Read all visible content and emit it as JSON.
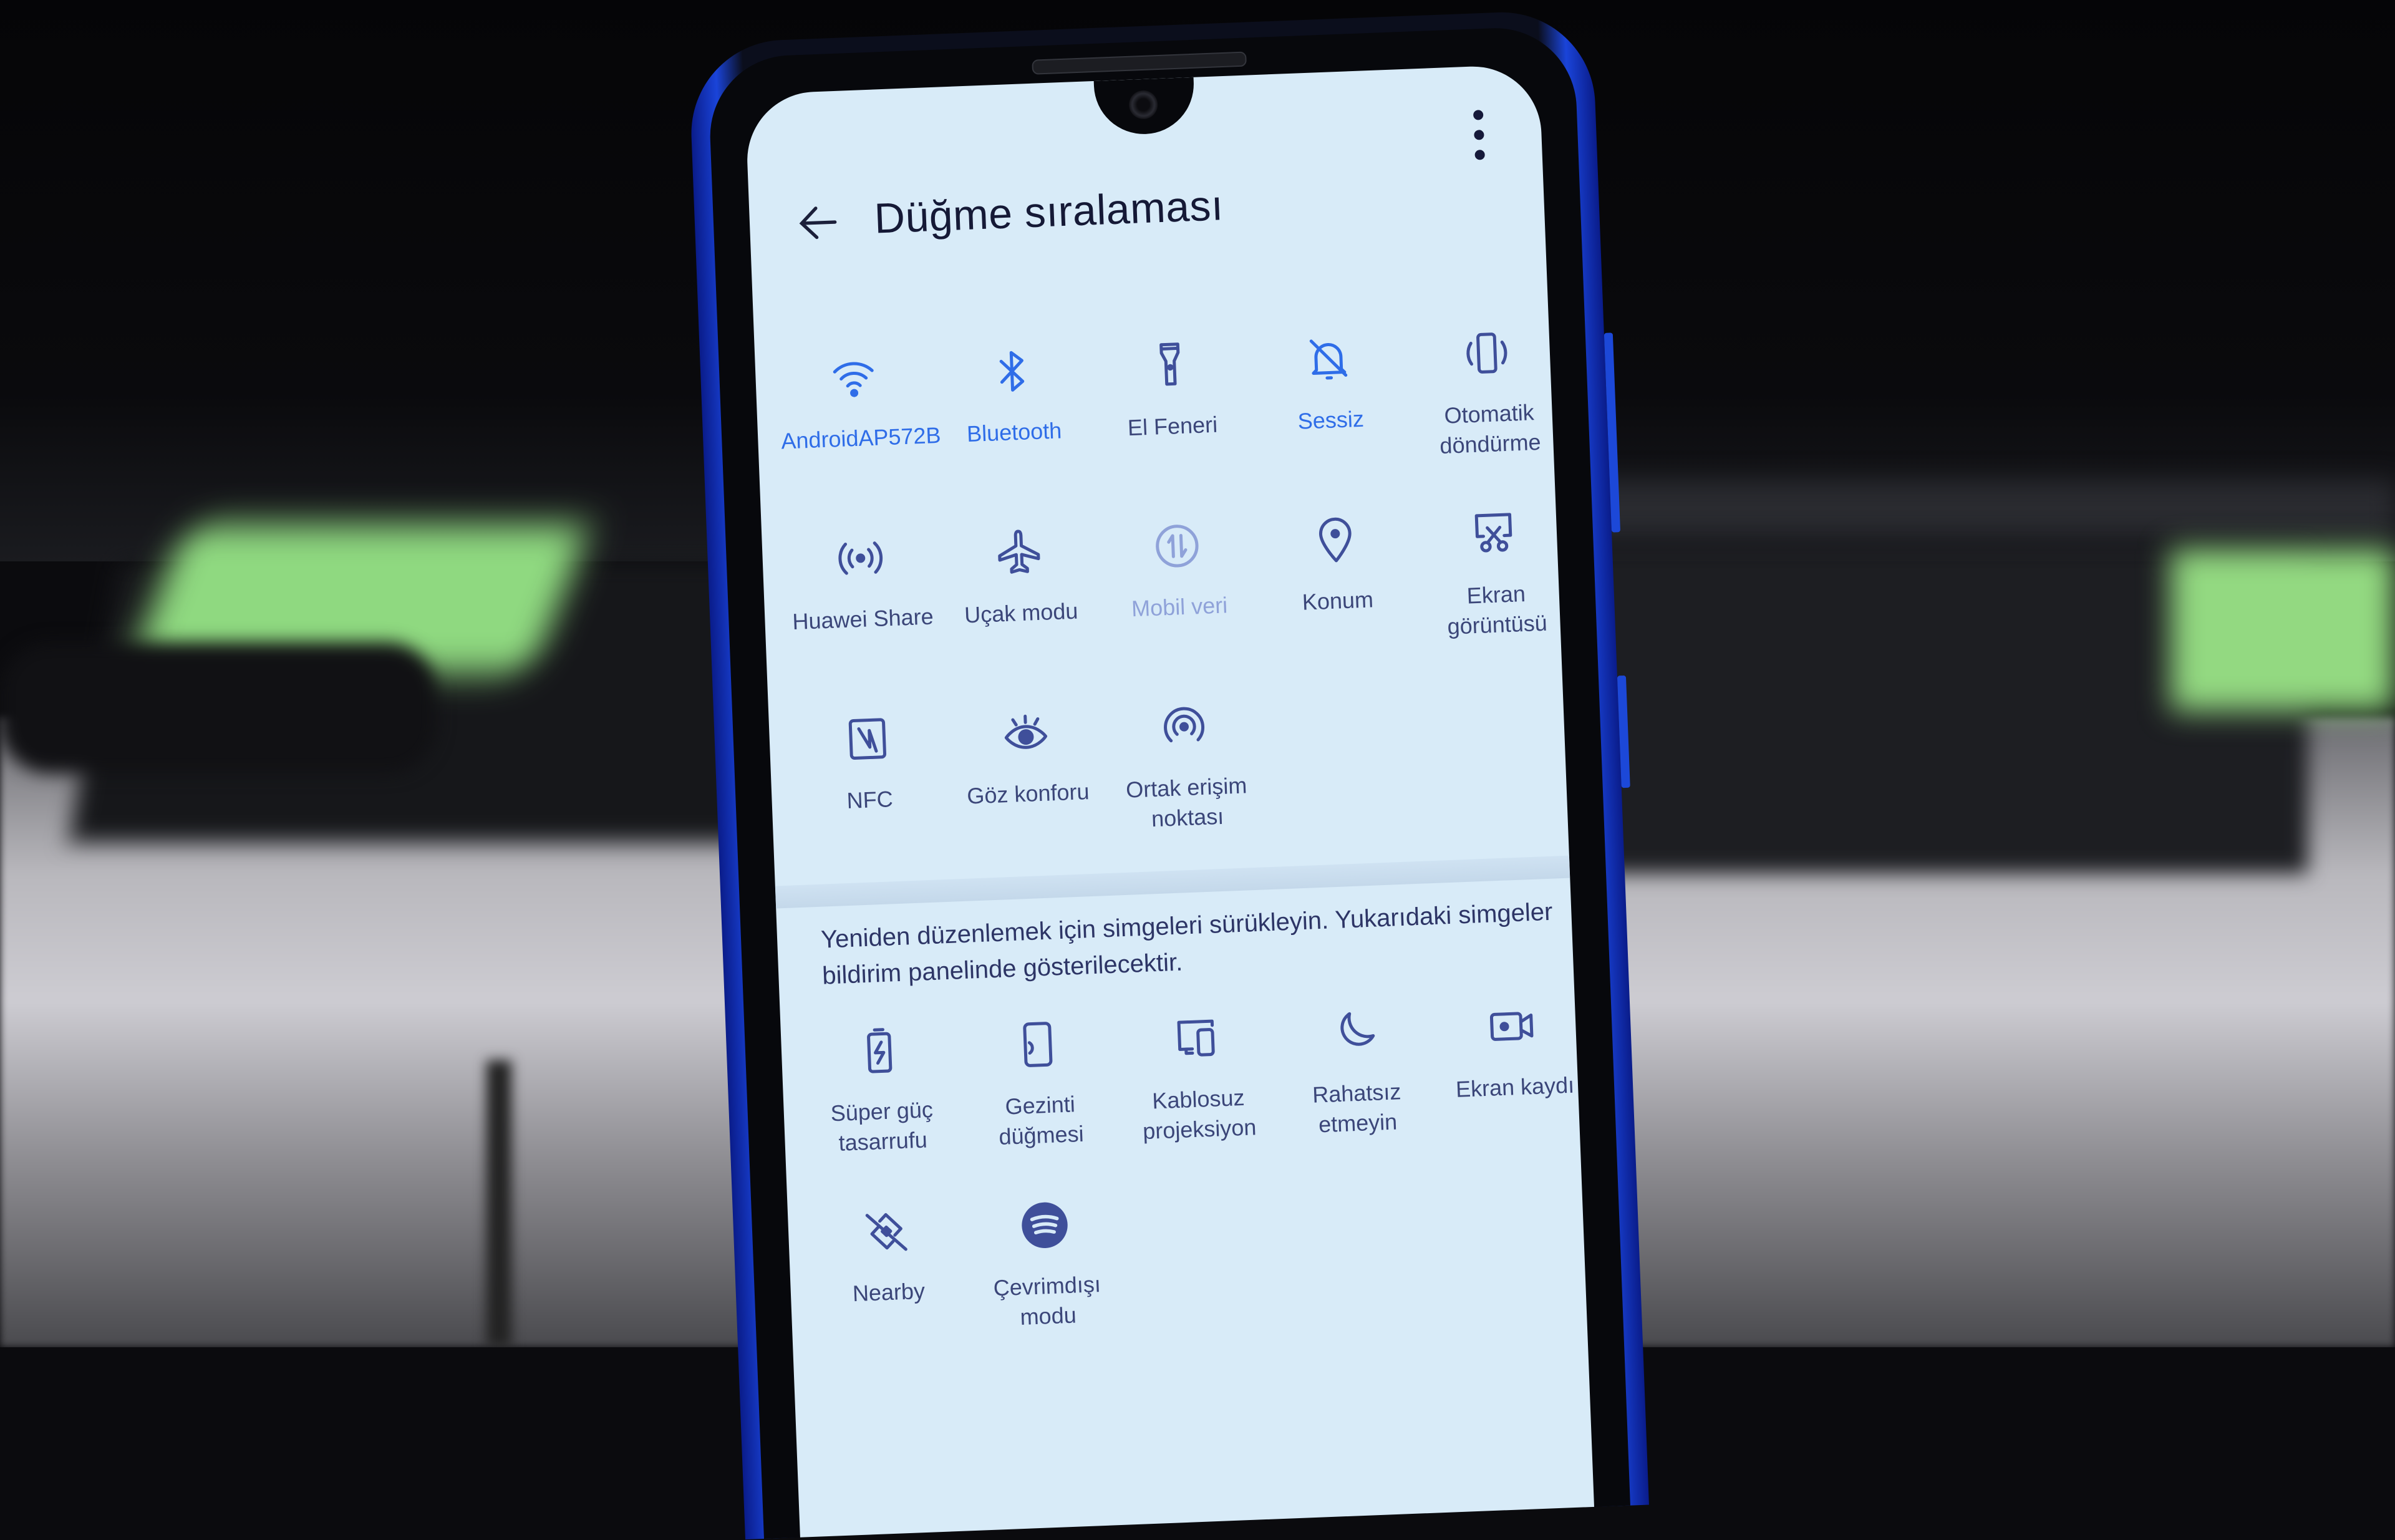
{
  "screen": {
    "title": "Düğme sıralaması",
    "back_icon": "arrow-left-icon",
    "menu_icon": "more-vertical-icon"
  },
  "active_tiles": [
    {
      "label": "AndroidAP572B",
      "icon": "wifi-icon",
      "state": "on"
    },
    {
      "label": "Bluetooth",
      "icon": "bluetooth-icon",
      "state": "on"
    },
    {
      "label": "El Feneri",
      "icon": "flashlight-icon",
      "state": "off"
    },
    {
      "label": "Sessiz",
      "icon": "bell-off-icon",
      "state": "on"
    },
    {
      "label": "Otomatik döndürme",
      "icon": "auto-rotate-icon",
      "state": "off"
    },
    {
      "label": "Huawei Share",
      "icon": "huawei-share-icon",
      "state": "off"
    },
    {
      "label": "Uçak modu",
      "icon": "airplane-icon",
      "state": "off"
    },
    {
      "label": "Mobil veri",
      "icon": "mobile-data-icon",
      "state": "disabled"
    },
    {
      "label": "Konum",
      "icon": "location-pin-icon",
      "state": "off"
    },
    {
      "label": "Ekran görüntüsü",
      "icon": "screenshot-icon",
      "state": "off"
    },
    {
      "label": "NFC",
      "icon": "nfc-icon",
      "state": "off"
    },
    {
      "label": "Göz konforu",
      "icon": "eye-comfort-icon",
      "state": "off"
    },
    {
      "label": "Ortak erişim noktası",
      "icon": "hotspot-icon",
      "state": "off"
    }
  ],
  "hint_text": "Yeniden düzenlemek için simgeleri sürükleyin. Yukarıdaki simgeler bildirim panelinde gösterilecektir.",
  "inactive_tiles": [
    {
      "label": "Süper güç tasarrufu",
      "icon": "battery-saver-icon"
    },
    {
      "label": "Gezinti düğmesi",
      "icon": "navigation-dock-icon"
    },
    {
      "label": "Kablosuz projeksiyon",
      "icon": "wireless-projection-icon"
    },
    {
      "label": "Rahatsız etmeyin",
      "icon": "moon-icon"
    },
    {
      "label": "Ekran kaydı",
      "icon": "screen-record-icon"
    },
    {
      "label": "Nearby",
      "icon": "nearby-off-icon"
    },
    {
      "label": "Çevrimdışı modu",
      "icon": "spotify-icon"
    }
  ],
  "colors": {
    "active": "#2f6de8",
    "inactive": "#3f4f9a",
    "disabled": "#8fa2d9",
    "screen_bg": "#d8ebf8",
    "phone_frame": "#1a44d9"
  }
}
